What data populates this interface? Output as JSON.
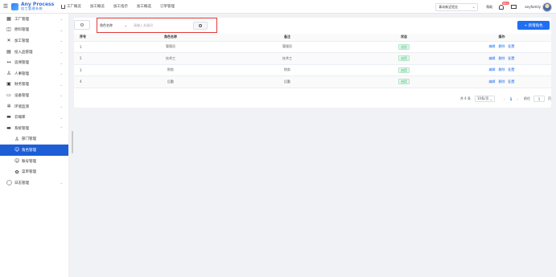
{
  "header": {
    "logo_title": "Any Process",
    "logo_subtitle": "加工管理系统",
    "nav": [
      "工厂概览",
      "加工概览",
      "加工指示",
      "加工概选",
      "订单管理"
    ],
    "factory_select": "青岛新迈铝业",
    "help": "帮助",
    "notif_count": "99+",
    "username": "anyfamily"
  },
  "sidebar": {
    "items": [
      {
        "label": "工厂管理",
        "icon": "▦"
      },
      {
        "label": "原料管理",
        "icon": "◫"
      },
      {
        "label": "加工管理",
        "icon": "✕"
      },
      {
        "label": "投入品管理",
        "icon": "▤"
      },
      {
        "label": "追溯管理",
        "icon": "↔"
      },
      {
        "label": "人事管理",
        "icon": "♙"
      },
      {
        "label": "财务管理",
        "icon": "▣"
      },
      {
        "label": "设备管理",
        "icon": "▭"
      },
      {
        "label": "环境监测",
        "icon": "✲"
      },
      {
        "label": "云端库",
        "icon": "▬"
      },
      {
        "label": "系统管理",
        "icon": "▬"
      }
    ],
    "sub_items": [
      {
        "label": "部门管理",
        "icon": "♙"
      },
      {
        "label": "角色管理",
        "icon": "☺"
      },
      {
        "label": "账号管理",
        "icon": "☺"
      },
      {
        "label": "菜单管理",
        "icon": "✿"
      }
    ],
    "last_item": {
      "label": "日志管理",
      "icon": "◯"
    }
  },
  "toolbar": {
    "field_select": "角色名称",
    "search_placeholder": "请输入关键词",
    "add_label": "+ 新增角色"
  },
  "table": {
    "columns": [
      "序号",
      "角色名称",
      "备注",
      "状态",
      "操作"
    ],
    "rows": [
      {
        "idx": "1",
        "name": "管理员",
        "remark": "管理员",
        "status": "启用"
      },
      {
        "idx": "2",
        "name": "技术工",
        "remark": "技术工",
        "status": "启用"
      },
      {
        "idx": "3",
        "name": "财务",
        "remark": "财务",
        "status": "启用"
      },
      {
        "idx": "4",
        "name": "后勤",
        "remark": "后勤",
        "status": "启用"
      }
    ],
    "ops": [
      "编辑",
      "删除",
      "配置"
    ]
  },
  "pager": {
    "total": "共 4 条",
    "page_size": "10条/页",
    "current": "1",
    "goto_label": "前往",
    "goto_value": "1",
    "page_suffix": "页"
  }
}
